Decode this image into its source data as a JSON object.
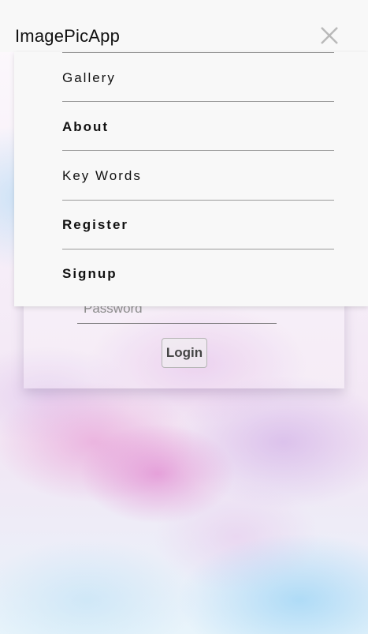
{
  "app": {
    "title": "ImagePicApp"
  },
  "login": {
    "password_placeholder": "Password",
    "login_label": "Login"
  },
  "menu": {
    "items": [
      {
        "label": "Gallery"
      },
      {
        "label": "About"
      },
      {
        "label": "Key Words"
      },
      {
        "label": "Register"
      },
      {
        "label": "Signup"
      }
    ]
  },
  "icons": {
    "close": "close-icon"
  }
}
